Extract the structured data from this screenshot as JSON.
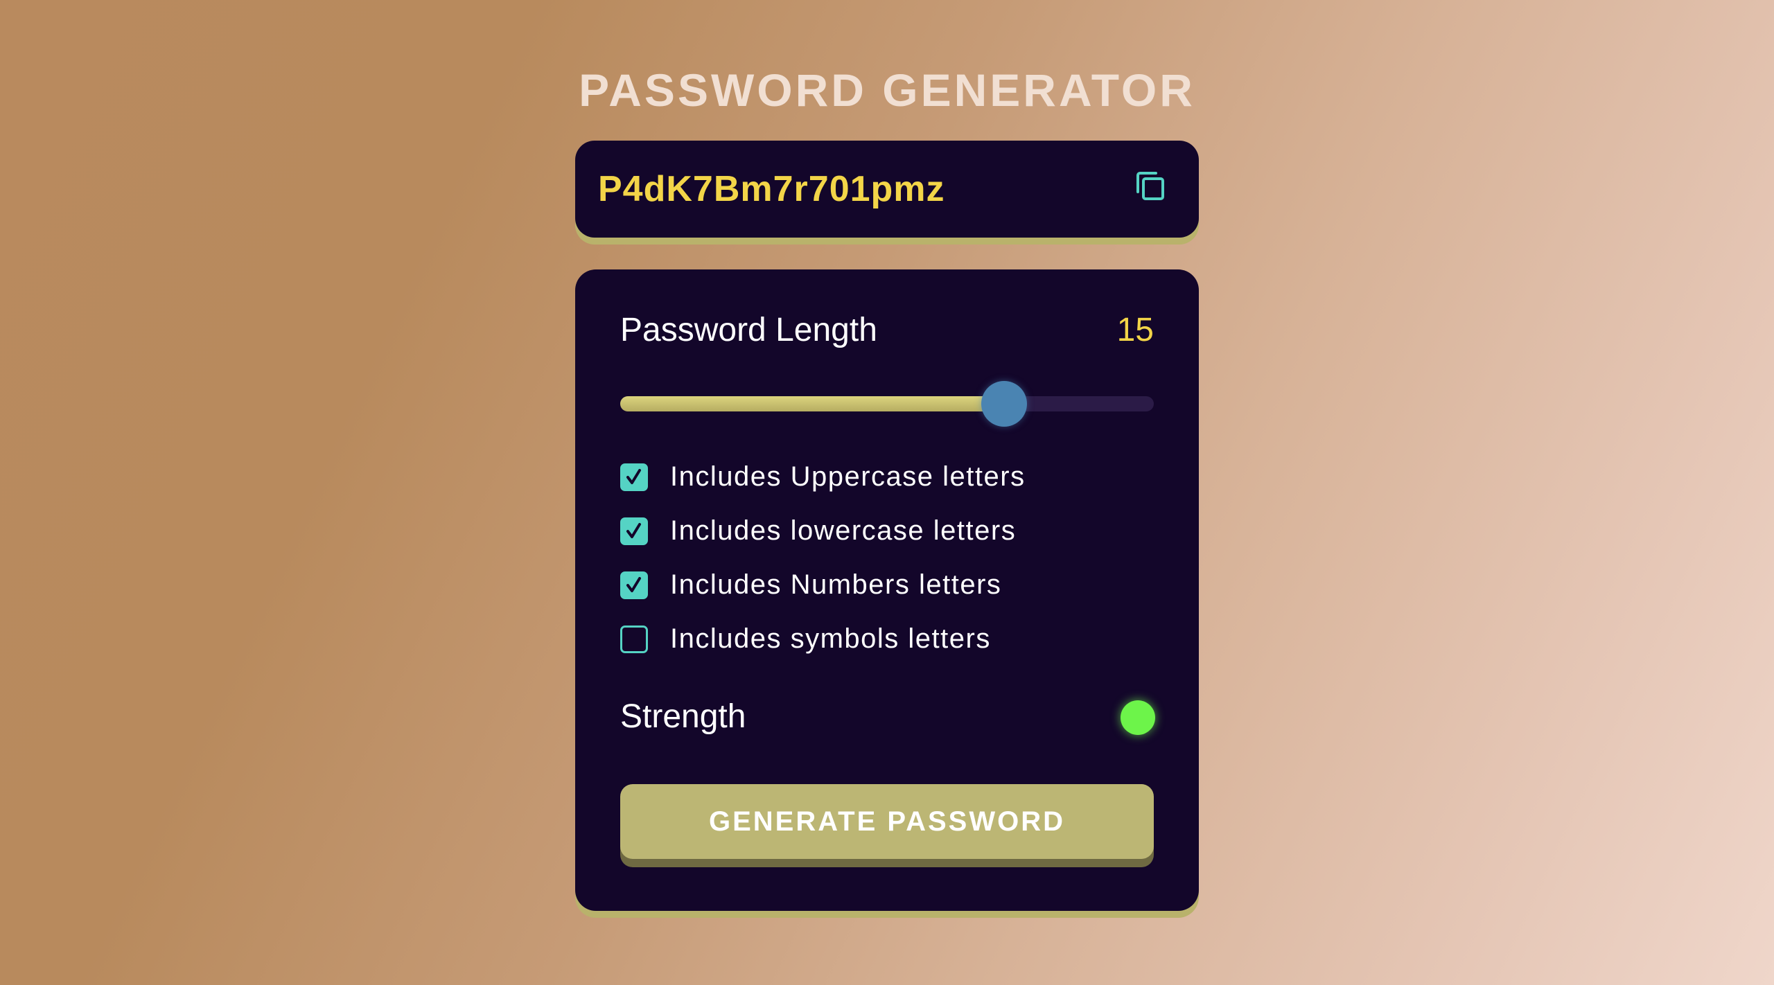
{
  "app": {
    "title": "PASSWORD GENERATOR"
  },
  "output": {
    "password": "P4dK7Bm7r701pmz",
    "copy_icon": "copy-icon"
  },
  "length": {
    "label": "Password Length",
    "value": "15",
    "slider_fraction": 0.72
  },
  "options": [
    {
      "label": "Includes Uppercase letters",
      "checked": true
    },
    {
      "label": "Includes lowercase letters",
      "checked": true
    },
    {
      "label": "Includes Numbers letters",
      "checked": true
    },
    {
      "label": "Includes symbols letters",
      "checked": false
    }
  ],
  "strength": {
    "label": "Strength",
    "indicator_color": "#6df44a"
  },
  "actions": {
    "generate_label": "GENERATE PASSWORD"
  },
  "colors": {
    "accent_yellow": "#f3d548",
    "accent_teal": "#55d3c4",
    "panel": "#13062a",
    "button": "#bcb674",
    "slider_thumb": "#4a84b2"
  }
}
